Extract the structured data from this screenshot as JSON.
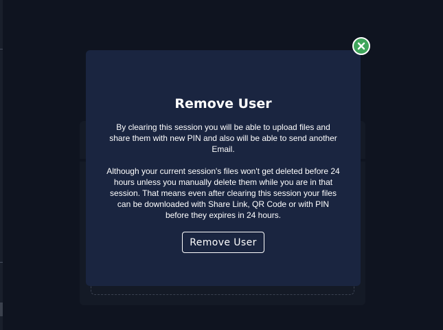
{
  "colors": {
    "page_background": "#0f1420",
    "modal_background": "#1a2540",
    "close_button": "#3fa55b",
    "text": "#ffffff"
  },
  "modal": {
    "title": "Remove User",
    "paragraph_1": "By clearing this session you will be able to upload files and share them with new PIN and also will be able to send another Email.",
    "paragraph_2": "Although your current session's files won't get deleted before 24 hours unless you manually delete them while you are in that session. That means even after clearing this session your files can be downloaded with Share Link, QR Code or with PIN before they expires in 24 hours.",
    "button_label": "Remove User",
    "close_icon": "close-icon"
  }
}
